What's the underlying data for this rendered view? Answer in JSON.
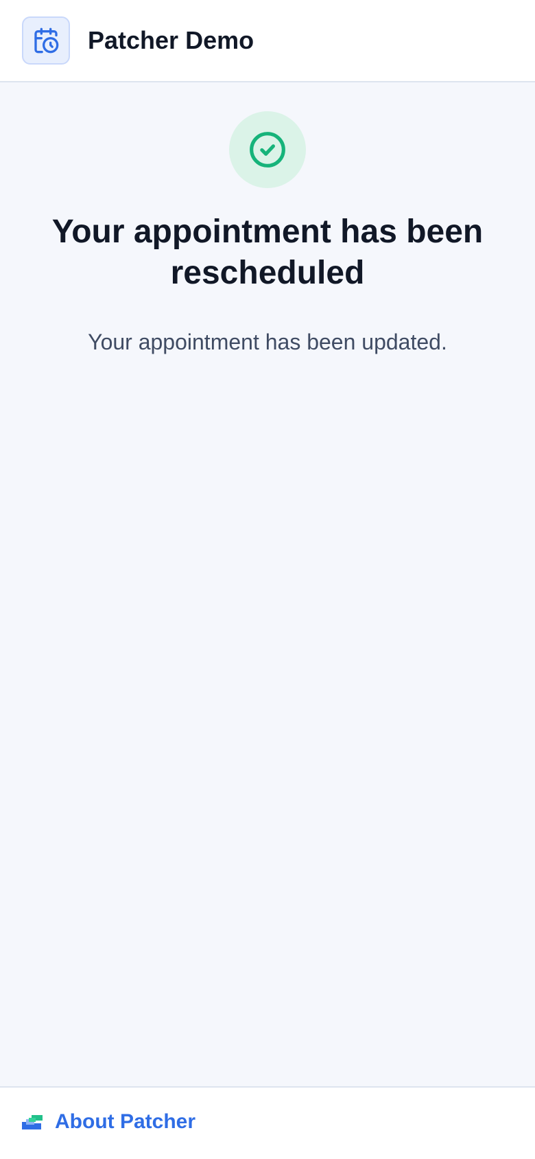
{
  "header": {
    "title": "Patcher Demo",
    "logo_icon": "calendar-clock-icon",
    "logo_color": "#2f6de5"
  },
  "main": {
    "status_icon": "check-circle-icon",
    "status_color": "#16b37a",
    "heading": "Your appointment has been rescheduled",
    "message": "Your appointment has been updated."
  },
  "footer": {
    "about_label": "About Patcher",
    "about_icon": "patcher-brand-icon",
    "link_color": "#2f6de5"
  }
}
